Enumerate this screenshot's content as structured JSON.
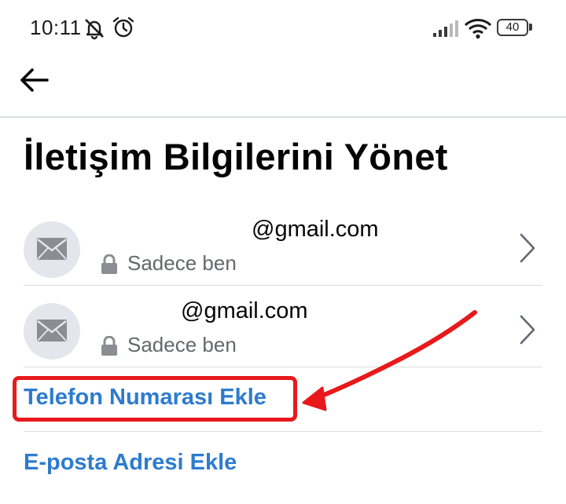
{
  "status_bar": {
    "time": "10:11",
    "battery_level": "40",
    "icons": [
      "notifications-muted-icon",
      "alarm-icon",
      "signal-icon",
      "wifi-icon",
      "battery-icon"
    ]
  },
  "header": {
    "back_icon": "back-arrow-icon"
  },
  "page": {
    "title": "İletişim Bilgilerini Yönet"
  },
  "contacts": [
    {
      "email": "@gmail.com",
      "privacy": "Sadece ben",
      "icon": "envelope-icon"
    },
    {
      "email": "@gmail.com",
      "privacy": "Sadece ben",
      "icon": "envelope-icon"
    }
  ],
  "actions": {
    "add_phone": "Telefon Numarası Ekle",
    "add_email": "E-posta Adresi Ekle"
  },
  "colors": {
    "link": "#2d7bcf",
    "annotation": "#e8191b",
    "secondary_text": "#65676b",
    "divider": "#dadde1"
  }
}
